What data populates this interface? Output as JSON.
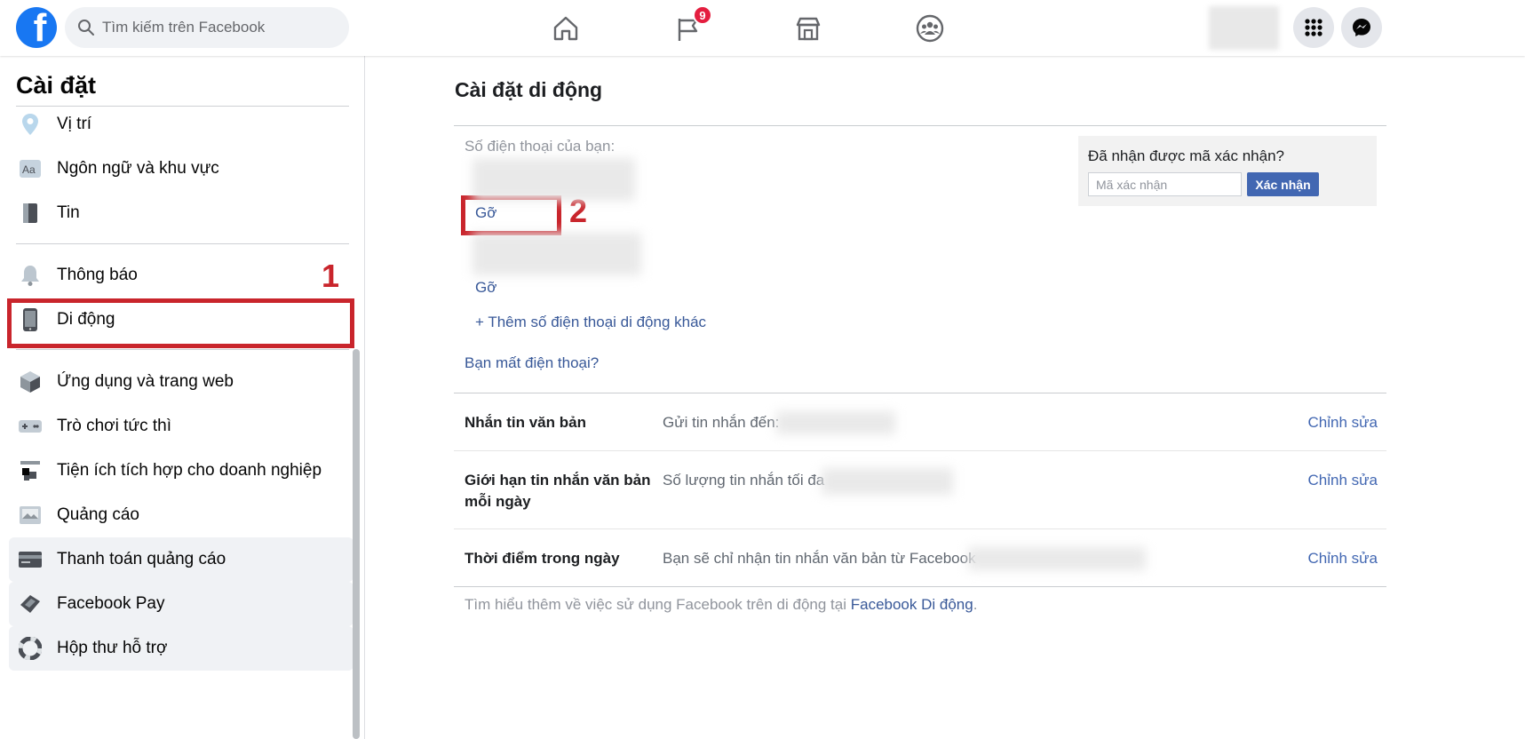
{
  "topbar": {
    "logo_letter": "f",
    "search_placeholder": "Tìm kiếm trên Facebook",
    "nav_badge_count": "9",
    "brand_color": "#1877f2",
    "nav_icons": [
      "home-icon",
      "pages-flag-icon",
      "marketplace-icon",
      "groups-icon"
    ],
    "right_icons": [
      "menu-grid-icon",
      "messenger-icon"
    ]
  },
  "sidebar": {
    "title": "Cài đặt",
    "items": [
      {
        "label": "Vị trí",
        "icon": "location-pin-icon"
      },
      {
        "label": "Ngôn ngữ và khu vực",
        "icon": "language-icon"
      },
      {
        "label": "Tin",
        "icon": "stories-icon"
      },
      {
        "label": "Thông báo",
        "icon": "bell-icon"
      },
      {
        "label": "Di động",
        "icon": "mobile-phone-icon"
      },
      {
        "label": "Ứng dụng và trang web",
        "icon": "apps-cube-icon"
      },
      {
        "label": "Trò chơi tức thì",
        "icon": "game-controller-icon"
      },
      {
        "label": "Tiện ích tích hợp cho doanh nghiệp",
        "icon": "business-integration-icon"
      },
      {
        "label": "Quảng cáo",
        "icon": "ads-icon"
      },
      {
        "label": "Thanh toán quảng cáo",
        "icon": "credit-card-icon"
      },
      {
        "label": "Facebook Pay",
        "icon": "facebook-pay-icon"
      },
      {
        "label": "Hộp thư hỗ trợ",
        "icon": "support-lifebuoy-icon"
      }
    ]
  },
  "annotations": {
    "step1": "1",
    "step2": "2"
  },
  "main": {
    "title": "Cài đặt di động",
    "phone_label": "Số điện thoại của bạn:",
    "remove_link_1": "Gỡ",
    "remove_link_2": "Gỡ",
    "add_phone_link": "+ Thêm số điện thoại di động khác",
    "lost_phone_link": "Bạn mất điện thoại?",
    "verify": {
      "title": "Đã nhận được mã xác nhận?",
      "placeholder": "Mã xác nhận",
      "button": "Xác nhận"
    },
    "rows": [
      {
        "label": "Nhắn tin văn bản",
        "desc": "Gửi tin nhắn đến:",
        "edit": "Chỉnh sửa"
      },
      {
        "label": "Giới hạn tin nhắn văn bản mỗi ngày",
        "desc": "Số lượng tin nhắn tối đa",
        "edit": "Chỉnh sửa"
      },
      {
        "label": "Thời điểm trong ngày",
        "desc": "Bạn sẽ chỉ nhận tin nhắn văn bản từ Facebook",
        "edit": "Chỉnh sửa"
      }
    ],
    "footer_text": "Tìm hiểu thêm về việc sử dụng Facebook trên di động tại ",
    "footer_link": "Facebook Di động",
    "footer_end": "."
  }
}
